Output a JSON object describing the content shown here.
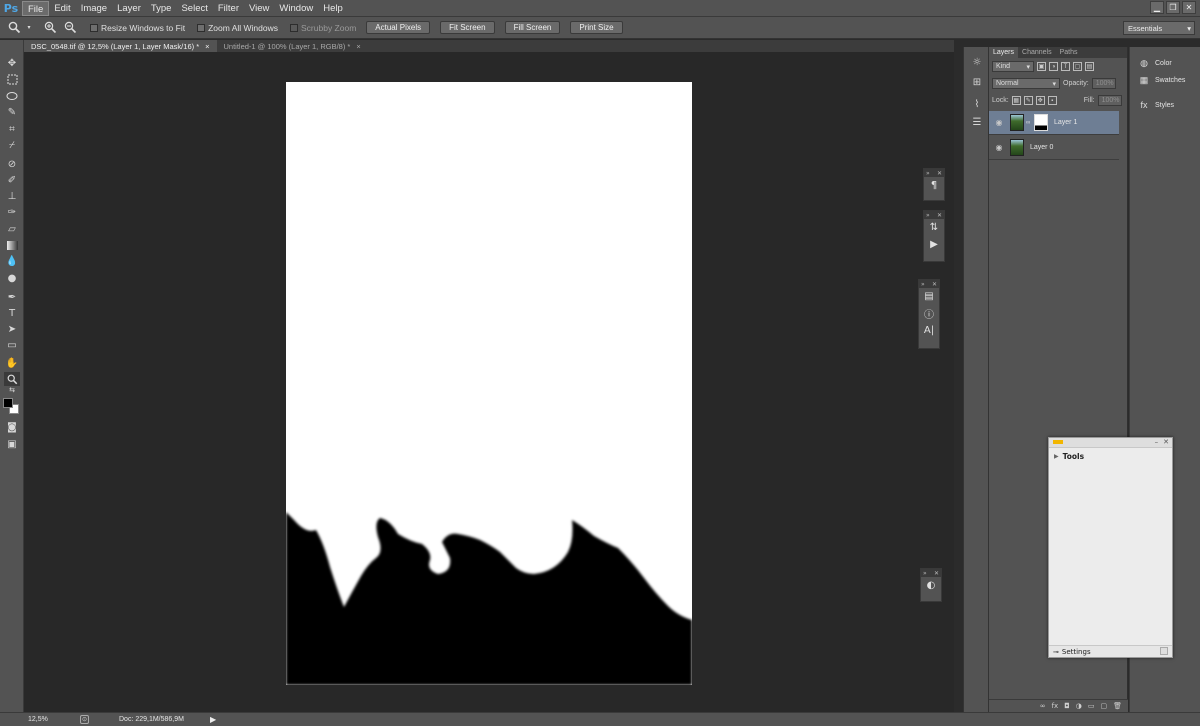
{
  "app": {
    "logo": "Ps"
  },
  "menu": [
    "File",
    "Edit",
    "Image",
    "Layer",
    "Type",
    "Select",
    "Filter",
    "View",
    "Window",
    "Help"
  ],
  "window_controls": {
    "minimize": "▁",
    "restore": "❐",
    "close": "✕"
  },
  "options_bar": {
    "tool_icon": "zoom-icon",
    "resize_windows_label": "Resize Windows to Fit",
    "zoom_all_windows_label": "Zoom All Windows",
    "scrubby_zoom_label": "Scrubby Zoom",
    "buttons": [
      "Actual Pixels",
      "Fit Screen",
      "Fill Screen",
      "Print Size"
    ],
    "workspace": "Essentials"
  },
  "tabs": [
    {
      "label": "DSC_0548.tif @ 12,5% (Layer 1, Layer Mask/16) *",
      "close": "×",
      "active": true
    },
    {
      "label": "Untitled-1 @ 100% (Layer 1, RGB/8) *",
      "close": "×",
      "active": false
    }
  ],
  "layers_panel": {
    "tabs": [
      "Layers",
      "Channels",
      "Paths"
    ],
    "filter_kind": "Kind",
    "blend_mode": "Normal",
    "opacity_label": "Opacity:",
    "opacity_value": "100%",
    "lock_label": "Lock:",
    "fill_label": "Fill:",
    "fill_value": "100%",
    "layers": [
      {
        "name": "Layer 1",
        "has_mask": true,
        "selected": true
      },
      {
        "name": "Layer 0",
        "has_mask": false,
        "selected": false
      }
    ]
  },
  "right_panels": [
    "Color",
    "Swatches",
    "Styles"
  ],
  "tools_window": {
    "title": "Tools",
    "footer": "Settings",
    "accent": "#f2b600"
  },
  "status": {
    "zoom": "12,5%",
    "doc": "Doc: 229,1M/586,9M"
  },
  "colors": {
    "ui_gray": "#535353",
    "canvas_bg": "#282828",
    "selected_layer": "#6e7e94",
    "ps_blue": "#4fa7e6"
  }
}
